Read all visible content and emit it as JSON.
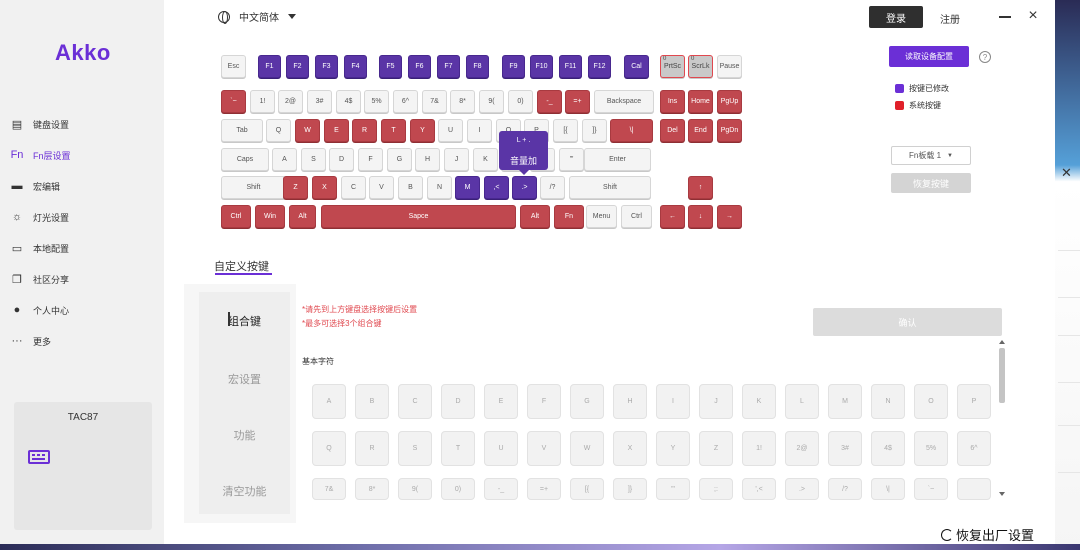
{
  "app": {
    "logo": "Akko",
    "language": "中文简体",
    "login_label": "登录",
    "register_label": "注册"
  },
  "sidebar": {
    "items": [
      {
        "label": "键盘设置",
        "icon": "keyboard-icon",
        "active": false
      },
      {
        "label": "Fn层设置",
        "icon": "fn-icon",
        "active": true
      },
      {
        "label": "宏编辑",
        "icon": "macro-icon",
        "active": false
      },
      {
        "label": "灯光设置",
        "icon": "light-icon",
        "active": false
      },
      {
        "label": "本地配置",
        "icon": "local-config-icon",
        "active": false
      },
      {
        "label": "社区分享",
        "icon": "community-icon",
        "active": false
      },
      {
        "label": "个人中心",
        "icon": "user-icon",
        "active": false
      },
      {
        "label": "更多",
        "icon": "more-icon",
        "active": false
      }
    ],
    "device": {
      "name": "TAC87",
      "icon": "keyboard-icon"
    }
  },
  "keyboard": {
    "rows": [
      [
        "Esc",
        "F1",
        "F2",
        "F3",
        "F4",
        "F5",
        "F6",
        "F7",
        "F8",
        "F9",
        "F10",
        "F11",
        "F12",
        "Cal",
        "PrtSc",
        "ScrLk",
        "Pause"
      ],
      [
        "`~",
        "1!",
        "2@",
        "3#",
        "4$",
        "5%",
        "6^",
        "7&",
        "8*",
        "9(",
        "0)",
        "-_",
        "=+",
        "Backspace",
        "Ins",
        "Home",
        "PgUp"
      ],
      [
        "Tab",
        "Q",
        "W",
        "E",
        "R",
        "T",
        "Y",
        "U",
        "I",
        "O",
        "P",
        "[{",
        "]}",
        "\\|",
        "Del",
        "End",
        "PgDn"
      ],
      [
        "Caps",
        "A",
        "S",
        "D",
        "F",
        "G",
        "H",
        "J",
        "K",
        "L",
        ";:",
        "'\"",
        "Enter"
      ],
      [
        "Shift",
        "Z",
        "X",
        "C",
        "V",
        "B",
        "N",
        "M",
        ",<",
        ".>",
        "/?",
        "Shift",
        "↑"
      ],
      [
        "Ctrl",
        "Win",
        "Alt",
        "Sapce",
        "Alt",
        "Fn",
        "Menu",
        "Ctrl",
        "←",
        "↓",
        "→"
      ]
    ],
    "tooltip": {
      "key": "L + .",
      "action": "音量加"
    },
    "corner_markers": {
      "PrtSc": "0",
      "ScrLk": "0"
    }
  },
  "side_panel": {
    "read_config_label": "读取设备配置",
    "help_icon": "help-icon",
    "legend": [
      {
        "label": "按键已修改",
        "color": "#6b2fd6"
      },
      {
        "label": "系统按键",
        "color": "#e0202a"
      }
    ],
    "fn_layer_value": "Fn板载 1",
    "restore_key_label": "恢复按键"
  },
  "colors": {
    "accent": "#6b2fd6",
    "modified_key": "#5a35a6",
    "system_key": "#c0484f"
  },
  "custom": {
    "tab_label": "自定义按键",
    "subnav": [
      {
        "label": "组合键",
        "active": true
      },
      {
        "label": "宏设置",
        "active": false
      },
      {
        "label": "功能",
        "active": false
      },
      {
        "label": "清空功能",
        "active": false
      }
    ],
    "hints": [
      "*请先到上方键盘选择按键后设置",
      "*最多可选择3个组合键"
    ],
    "confirm_label": "确认",
    "section_label": "基本字符",
    "char_rows": [
      [
        "A",
        "B",
        "C",
        "D",
        "E",
        "F",
        "G",
        "H",
        "I",
        "J",
        "K",
        "L",
        "M",
        "N",
        "O",
        "P"
      ],
      [
        "Q",
        "R",
        "S",
        "T",
        "U",
        "V",
        "W",
        "X",
        "Y",
        "Z",
        "1!",
        "2@",
        "3#",
        "4$",
        "5%",
        "6^"
      ],
      [
        "7&",
        "8*",
        "9(",
        "0)",
        "-_",
        "=+",
        "[{",
        "]}",
        "'\"",
        ";:",
        "',<",
        ".>",
        "/?",
        "\\|",
        "`~",
        ""
      ]
    ]
  },
  "footer": {
    "factory_reset_label": "恢复出厂设置"
  }
}
